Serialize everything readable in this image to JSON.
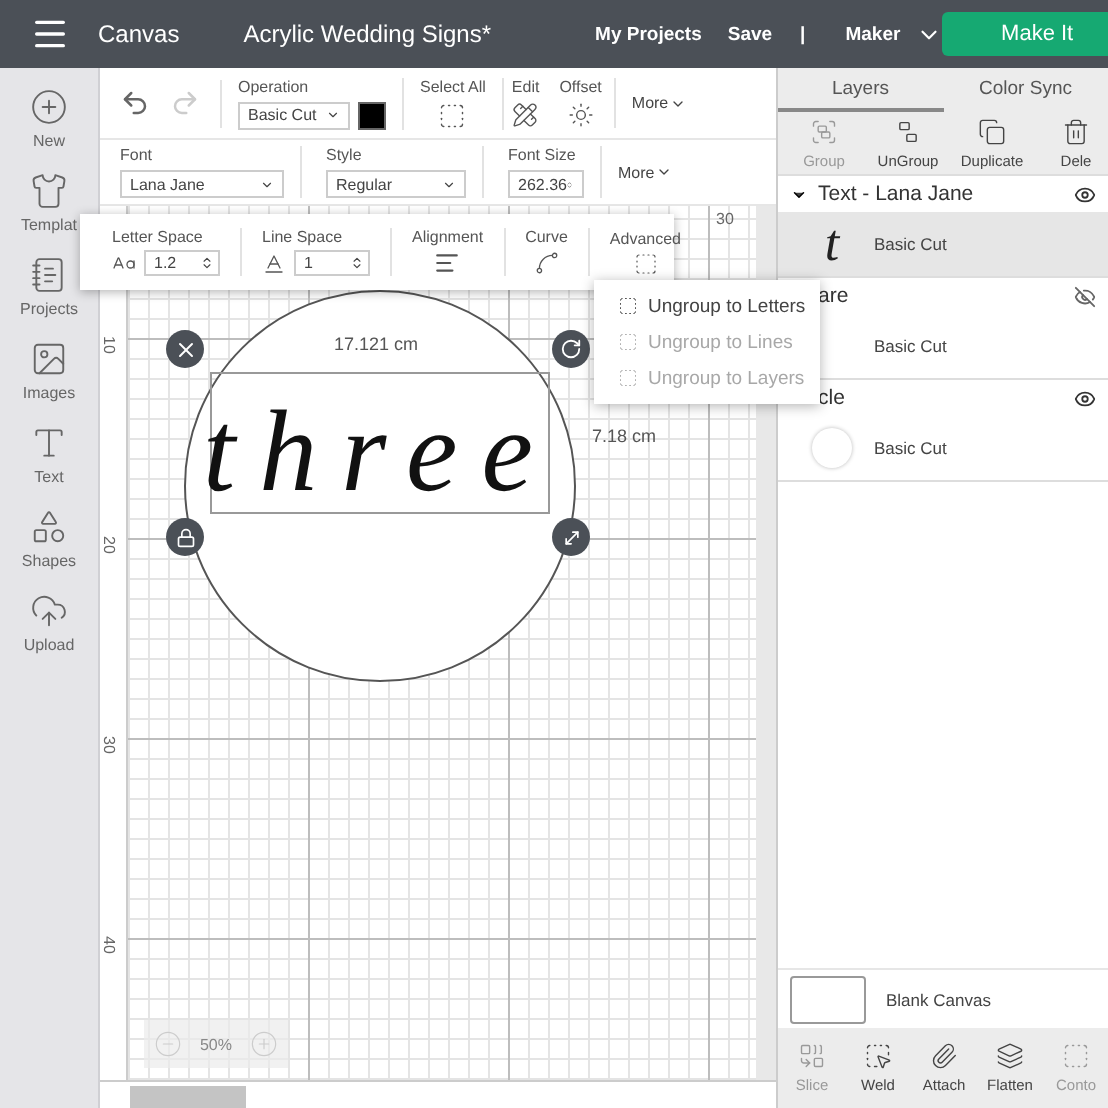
{
  "header": {
    "app": "Canvas",
    "project_title": "Acrylic Wedding Signs*",
    "links": [
      "My Projects",
      "Save"
    ],
    "separator": "|",
    "machine": "Maker",
    "make_it": "Make It"
  },
  "sidebar": [
    {
      "kind": "new",
      "label": "New"
    },
    {
      "kind": "templates",
      "label": "Templat"
    },
    {
      "kind": "projects",
      "label": "Projects"
    },
    {
      "kind": "images",
      "label": "Images"
    },
    {
      "kind": "text",
      "label": "Text"
    },
    {
      "kind": "shapes",
      "label": "Shapes"
    },
    {
      "kind": "upload",
      "label": "Upload"
    }
  ],
  "toolbar": {
    "undo_disabled": false,
    "redo_disabled": true,
    "operation": {
      "label": "Operation",
      "value": "Basic Cut",
      "color": "#000000"
    },
    "select_all": "Select All",
    "edit": "Edit",
    "offset": "Offset",
    "more": "More"
  },
  "text_toolbar": {
    "font": {
      "label": "Font",
      "value": "Lana Jane"
    },
    "style": {
      "label": "Style",
      "value": "Regular"
    },
    "font_size": {
      "label": "Font Size",
      "value": "262.36"
    },
    "more": "More"
  },
  "text_popup": {
    "letter_space": {
      "label": "Letter Space",
      "value": "1.2"
    },
    "line_space": {
      "label": "Line Space",
      "value": "1"
    },
    "alignment": "Alignment",
    "curve": "Curve",
    "advanced": "Advanced"
  },
  "advanced_menu": [
    {
      "label": "Ungroup to Letters",
      "disabled": false
    },
    {
      "label": "Ungroup to Lines",
      "disabled": true
    },
    {
      "label": "Ungroup to Layers",
      "disabled": true
    }
  ],
  "canvas": {
    "ruler_marks": [
      "10",
      "20",
      "30",
      "40"
    ],
    "top_ruler_mark": "30",
    "text": "three",
    "width_label": "17.121 cm",
    "height_label": "7.18 cm",
    "zoom": "50%"
  },
  "layers_panel": {
    "tabs": [
      {
        "label": "Layers",
        "selected": true
      },
      {
        "label": "Color Sync",
        "selected": false
      }
    ],
    "actions": [
      {
        "kind": "group",
        "label": "Group",
        "disabled": true
      },
      {
        "kind": "ungroup",
        "label": "UnGroup",
        "disabled": false
      },
      {
        "kind": "duplicate",
        "label": "Duplicate",
        "disabled": false
      },
      {
        "kind": "delete",
        "label": "Dele",
        "disabled": false
      }
    ],
    "layers": [
      {
        "title": "Text - Lana Jane",
        "visible": true,
        "children": [
          {
            "kind": "letter",
            "glyph": "t",
            "label": "Basic Cut",
            "selected": true
          }
        ]
      },
      {
        "title": "are",
        "visible": false,
        "children": [
          {
            "kind": "blank",
            "label": "Basic Cut",
            "selected": false
          }
        ]
      },
      {
        "title": "cle",
        "visible": true,
        "children": [
          {
            "kind": "circle",
            "label": "Basic Cut",
            "selected": false
          }
        ]
      }
    ],
    "blank_canvas": "Blank Canvas",
    "bottom_actions": [
      {
        "kind": "slice",
        "label": "Slice",
        "disabled": true
      },
      {
        "kind": "weld",
        "label": "Weld",
        "disabled": false
      },
      {
        "kind": "attach",
        "label": "Attach",
        "disabled": false
      },
      {
        "kind": "flatten",
        "label": "Flatten",
        "disabled": false
      },
      {
        "kind": "contour",
        "label": "Conto",
        "disabled": true
      }
    ]
  }
}
